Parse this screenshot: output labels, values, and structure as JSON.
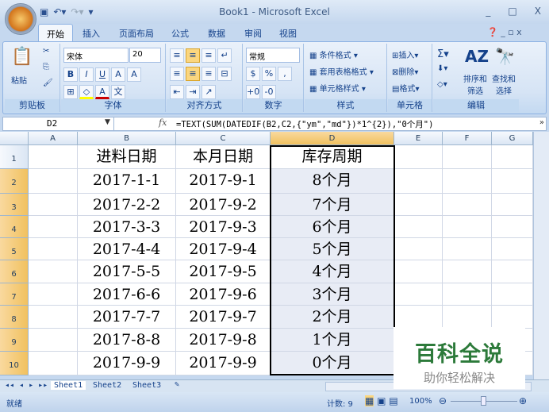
{
  "window": {
    "title": "Book1 - Microsoft Excel"
  },
  "tabs": [
    "开始",
    "插入",
    "页面布局",
    "公式",
    "数据",
    "审阅",
    "视图"
  ],
  "ribbon": {
    "clipboard": {
      "paste": "粘贴",
      "label": "剪贴板"
    },
    "font": {
      "name": "宋体",
      "size": "20",
      "label": "字体"
    },
    "alignment": {
      "label": "对齐方式"
    },
    "number": {
      "format": "常规",
      "percent": "%",
      "comma": ",",
      "label": "数字"
    },
    "styles": {
      "conditional": "条件格式",
      "table": "套用表格格式",
      "cell": "单元格样式",
      "label": "样式"
    },
    "cells": {
      "insert": "插入",
      "delete": "删除",
      "format": "格式",
      "label": "单元格"
    },
    "editing": {
      "sort1": "排序和",
      "sort2": "筛选",
      "find1": "查找和",
      "find2": "选择",
      "label": "编辑"
    }
  },
  "formula_bar": {
    "name_box": "D2",
    "fx": "fx",
    "formula": "=TEXT(SUM(DATEDIF(B2,C2,{\"ym\",\"md\"})*1^{2}),\"0个月\")"
  },
  "columns": [
    "A",
    "B",
    "C",
    "D",
    "E",
    "F",
    "G"
  ],
  "rows": [
    [
      "",
      "进料日期",
      "本月日期",
      "库存周期"
    ],
    [
      "",
      "2017-1-1",
      "2017-9-1",
      "8个月"
    ],
    [
      "",
      "2017-2-2",
      "2017-9-2",
      "7个月"
    ],
    [
      "",
      "2017-3-3",
      "2017-9-3",
      "6个月"
    ],
    [
      "",
      "2017-4-4",
      "2017-9-4",
      "5个月"
    ],
    [
      "",
      "2017-5-5",
      "2017-9-5",
      "4个月"
    ],
    [
      "",
      "2017-6-6",
      "2017-9-6",
      "3个月"
    ],
    [
      "",
      "2017-7-7",
      "2017-9-7",
      "2个月"
    ],
    [
      "",
      "2017-8-8",
      "2017-9-8",
      "1个月"
    ],
    [
      "",
      "2017-9-9",
      "2017-9-9",
      "0个月"
    ]
  ],
  "sheets": [
    "Sheet1",
    "Sheet2",
    "Sheet3"
  ],
  "status": {
    "ready": "就绪",
    "count": "计数: 9",
    "zoom": "100%"
  },
  "watermark": {
    "line1": "百科全说",
    "line2": "助你轻松解决"
  }
}
